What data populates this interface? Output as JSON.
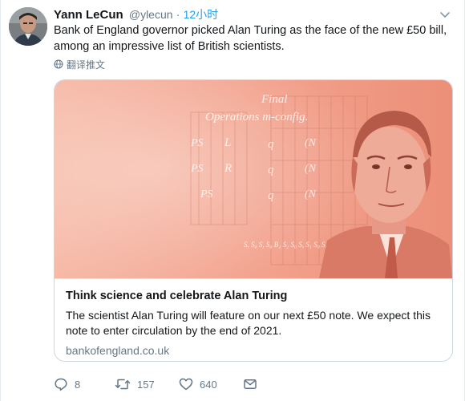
{
  "tweet": {
    "name": "Yann LeCun",
    "handle": "@ylecun",
    "separator": "·",
    "time": "12小时",
    "text": "Bank of England governor picked Alan Turing as the face of the new £50 bill, among an impressive list of British scientists.",
    "translate_label": "翻译推文"
  },
  "card": {
    "image_text": {
      "heading_1": "Final",
      "heading_2": "Operations m-config.",
      "row_1_left": "PS",
      "row_1_mid": "L",
      "row_1_q": "q",
      "row_1_n": "(N",
      "row_2_left": "PS",
      "row_2_mid": "R",
      "row_2_q": "q",
      "row_2_n": "(N",
      "row_3_left": "PS",
      "row_3_q": "q",
      "row_3_n": "(N",
      "sequence": "S, S₀ S, S₀ B₁ S₂ S₀ S, S₁ S₀ S₀ B₂"
    },
    "title": "Think science and celebrate Alan Turing",
    "description": "The scientist Alan Turing will feature on our next £50 note. We expect this note to enter circulation by the end of 2021.",
    "domain": "bankofengland.co.uk"
  },
  "actions": {
    "reply_count": "8",
    "retweet_count": "157",
    "like_count": "640"
  },
  "icons": {
    "reply": "reply-icon",
    "retweet": "retweet-icon",
    "like": "heart-icon",
    "dm": "envelope-icon",
    "caret": "chevron-down-icon",
    "translate": "globe-icon"
  },
  "colors": {
    "link_blue": "#1da1f2",
    "muted": "#657786",
    "card_pink": "#f3a08e"
  }
}
